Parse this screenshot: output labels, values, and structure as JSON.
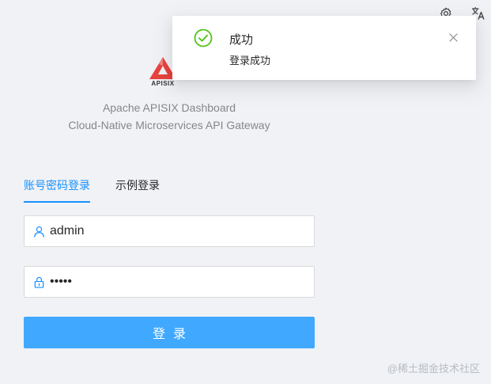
{
  "header": {
    "settings_icon": "gear-icon",
    "language_icon": "translate-icon"
  },
  "brand": {
    "logo_text": "APISIX",
    "title": "Apache APISIX Dashboard",
    "subtitle": "Cloud-Native Microservices API Gateway"
  },
  "tabs": [
    {
      "label": "账号密码登录",
      "active": true
    },
    {
      "label": "示例登录",
      "active": false
    }
  ],
  "form": {
    "username": {
      "value": "admin",
      "icon": "user-icon"
    },
    "password": {
      "value": "admin",
      "icon": "lock-icon"
    },
    "submit_label": "登录"
  },
  "notification": {
    "title": "成功",
    "description": "登录成功",
    "icon": "check-circle-icon",
    "close_icon": "close-icon"
  },
  "watermark": "@稀土掘金技术社区",
  "colors": {
    "primary": "#1890ff",
    "button": "#40a9ff",
    "success": "#52c41a",
    "logo_red": "#e8433e"
  }
}
